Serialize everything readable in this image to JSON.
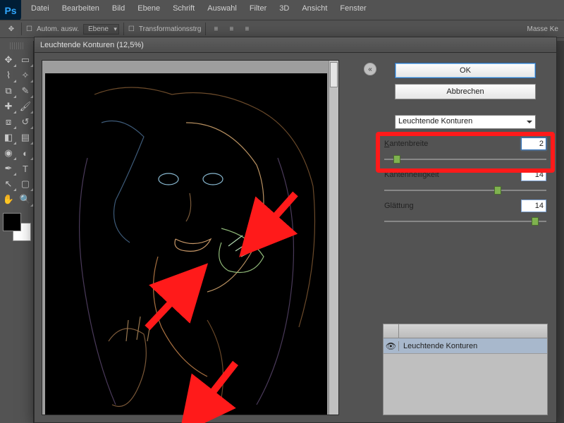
{
  "app": {
    "logo": "Ps"
  },
  "menu": [
    "Datei",
    "Bearbeiten",
    "Bild",
    "Ebene",
    "Schrift",
    "Auswahl",
    "Filter",
    "3D",
    "Ansicht",
    "Fenster"
  ],
  "options": {
    "auto_select": "Autom. ausw.",
    "layer_dd": "Ebene",
    "transform": "Transformationsstrg",
    "right_label": "Masse Ke"
  },
  "dialog": {
    "title": "Leuchtende Konturen (12,5%)",
    "ok": "OK",
    "cancel": "Abbrechen",
    "filter_name": "Leuchtende Konturen",
    "params": {
      "edge_width_label": "Kantenbreite",
      "edge_width_value": "2",
      "edge_bright_label": "Kantenhelligkeit",
      "edge_bright_value": "14",
      "smooth_label": "Glättung",
      "smooth_value": "14"
    },
    "layers_panel": {
      "active_layer": "Leuchtende Konturen"
    }
  },
  "slider_positions": {
    "edge_width_pct": 8,
    "edge_bright_pct": 70,
    "smooth_pct": 93
  }
}
